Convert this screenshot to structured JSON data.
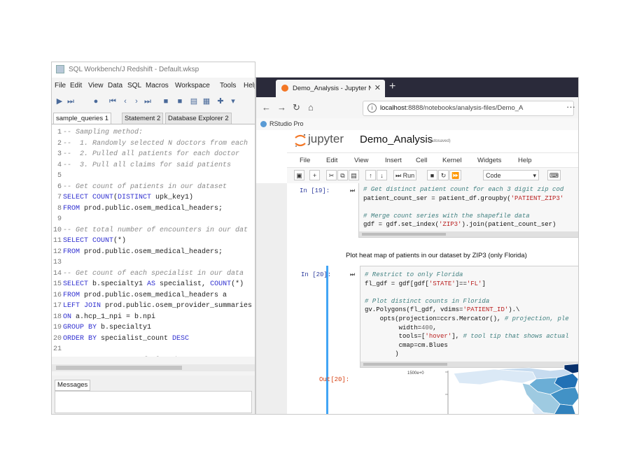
{
  "sql_workbench": {
    "title": "SQL Workbench/J Redshift - Default.wksp",
    "menu": [
      "File",
      "Edit",
      "View",
      "Data",
      "SQL",
      "Macros",
      "Workspace",
      "Tools",
      "Help"
    ],
    "tabs": [
      "sample_queries 1",
      "Statement 2",
      "Database Explorer 2"
    ],
    "editor_lines": [
      {
        "n": "1",
        "parts": [
          [
            "cmt",
            "-- Sampling method:"
          ]
        ]
      },
      {
        "n": "2",
        "parts": [
          [
            "cmt",
            "--  1. Randomly selected N doctors from each"
          ]
        ]
      },
      {
        "n": "3",
        "parts": [
          [
            "cmt",
            "--  2. Pulled all patients for each doctor"
          ]
        ]
      },
      {
        "n": "4",
        "parts": [
          [
            "cmt",
            "--  3. Pull all claims for said patients"
          ]
        ]
      },
      {
        "n": "5",
        "parts": []
      },
      {
        "n": "6",
        "parts": [
          [
            "cmt",
            "-- Get count of patients in our dataset"
          ]
        ]
      },
      {
        "n": "7",
        "parts": [
          [
            "kw",
            "SELECT COUNT"
          ],
          [
            "tx",
            "("
          ],
          [
            "kw",
            "DISTINCT"
          ],
          [
            "tx",
            " upk_key1)"
          ]
        ]
      },
      {
        "n": "8",
        "parts": [
          [
            "kw",
            "FROM"
          ],
          [
            "tx",
            " prod.public.osem_medical_headers;"
          ]
        ]
      },
      {
        "n": "9",
        "parts": []
      },
      {
        "n": "10",
        "parts": [
          [
            "cmt",
            "-- Get total number of encounters in our dat"
          ]
        ]
      },
      {
        "n": "11",
        "parts": [
          [
            "kw",
            "SELECT COUNT"
          ],
          [
            "tx",
            "(*)"
          ]
        ]
      },
      {
        "n": "12",
        "parts": [
          [
            "kw",
            "FROM"
          ],
          [
            "tx",
            " prod.public.osem_medical_headers;"
          ]
        ]
      },
      {
        "n": "13",
        "parts": []
      },
      {
        "n": "14",
        "parts": [
          [
            "cmt",
            "-- Get count of each specialist in our data"
          ]
        ]
      },
      {
        "n": "15",
        "parts": [
          [
            "kw",
            "SELECT"
          ],
          [
            "tx",
            " b.specialty1 "
          ],
          [
            "kw",
            "AS"
          ],
          [
            "tx",
            " specialist, "
          ],
          [
            "kw",
            "COUNT"
          ],
          [
            "tx",
            "(*)"
          ]
        ]
      },
      {
        "n": "16",
        "parts": [
          [
            "kw",
            "FROM"
          ],
          [
            "tx",
            " prod.public.osem_medical_headers a"
          ]
        ]
      },
      {
        "n": "17",
        "parts": [
          [
            "kw",
            "LEFT JOIN"
          ],
          [
            "tx",
            " prod.public.osem_provider_summaries"
          ]
        ]
      },
      {
        "n": "18",
        "parts": [
          [
            "kw",
            "ON"
          ],
          [
            "tx",
            " a.hcp_1_npi = b.npi"
          ]
        ]
      },
      {
        "n": "19",
        "parts": [
          [
            "kw",
            "GROUP BY"
          ],
          [
            "tx",
            " b.specialty1"
          ]
        ]
      },
      {
        "n": "20",
        "parts": [
          [
            "kw",
            "ORDER BY"
          ],
          [
            "tx",
            " specialist_count "
          ],
          [
            "kw",
            "DESC"
          ]
        ]
      },
      {
        "n": "21",
        "parts": []
      },
      {
        "n": "22",
        "parts": [
          [
            "cmt",
            "-- Get percentage of closed encounters"
          ]
        ]
      }
    ],
    "messages_tab": "Messages"
  },
  "browser": {
    "tab_title": "Demo_Analysis - Jupyter Notebook",
    "url_host": "localhost",
    "url_rest": ":8888/notebooks/analysis-files/Demo_A",
    "bookmark": "RStudio Pro"
  },
  "jupyter": {
    "logo_text": "jupyter",
    "notebook_name": "Demo_Analysis",
    "autosave": "(autosaved)",
    "menu": [
      "File",
      "Edit",
      "View",
      "Insert",
      "Cell",
      "Kernel",
      "Widgets",
      "Help"
    ],
    "run_label": "Run",
    "cell_type": "Code",
    "cell1": {
      "prompt": "In [19]:",
      "lines": [
        [
          [
            "jc",
            "# Get distinct patient count for each 3 digit zip cod"
          ]
        ],
        [
          [
            "jt",
            "patient_count_ser = patient_df.groupby("
          ],
          [
            "js",
            "'PATIENT_ZIP3'"
          ]
        ],
        [],
        [
          [
            "jc",
            "# Merge count series with the shapefile data"
          ]
        ],
        [
          [
            "jt",
            "gdf = gdf.set_index("
          ],
          [
            "js",
            "'ZIP3'"
          ],
          [
            "jt",
            ").join(patient_count_ser)"
          ]
        ]
      ]
    },
    "markdown": "Plot heat map of patients in our dataset by ZIP3 (only Florida)",
    "cell2": {
      "prompt": "In [20]:",
      "lines": [
        [
          [
            "jc",
            "# Restrict to only Florida"
          ]
        ],
        [
          [
            "jt",
            "fl_gdf = gdf[gdf["
          ],
          [
            "js",
            "'STATE'"
          ],
          [
            "jt",
            "]=="
          ],
          [
            "js",
            "'FL'"
          ],
          [
            "jt",
            "]"
          ]
        ],
        [],
        [
          [
            "jc",
            "# Plot distinct counts in Florida"
          ]
        ],
        [
          [
            "jt",
            "gv.Polygons(fl_gdf, vdims="
          ],
          [
            "js",
            "'PATIENT_ID'"
          ],
          [
            "jt",
            ").\\"
          ]
        ],
        [
          [
            "jt",
            "    opts(projection=ccrs.Mercator(), "
          ],
          [
            "jc",
            "# projection, ple"
          ]
        ],
        [
          [
            "jt",
            "         width="
          ],
          [
            "jn",
            "400"
          ],
          [
            "jt",
            ","
          ]
        ],
        [
          [
            "jt",
            "         tools=["
          ],
          [
            "js",
            "'hover'"
          ],
          [
            "jt",
            "], "
          ],
          [
            "jc",
            "# tool tip that shows actual"
          ]
        ],
        [
          [
            "jt",
            "         cmap=cm.Blues"
          ]
        ],
        [
          [
            "jt",
            "        )"
          ]
        ]
      ]
    },
    "out_prompt": "Out[20]:",
    "heatmap_tick": "1500e+0"
  }
}
